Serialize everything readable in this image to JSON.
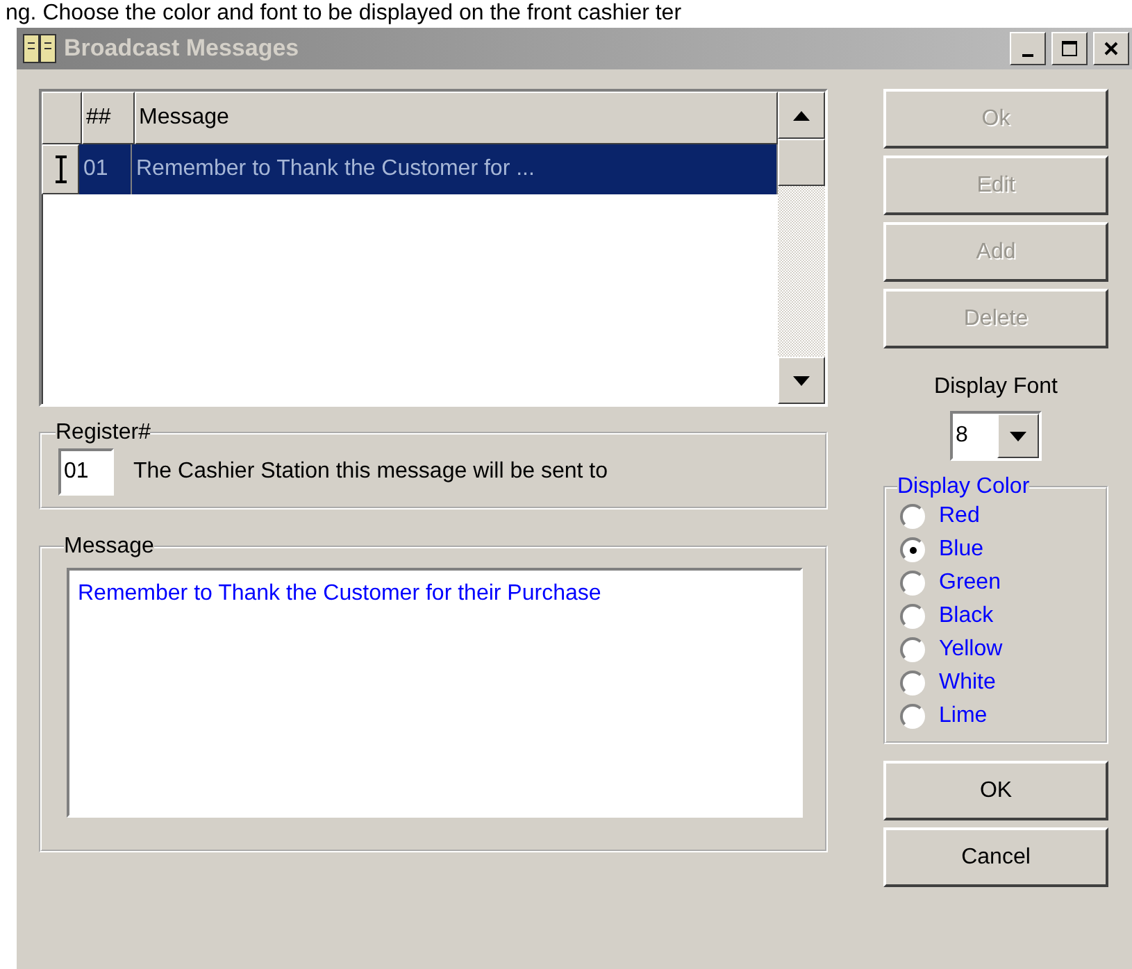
{
  "caption": "ng. Choose the color and font to be displayed on the front cashier ter",
  "window": {
    "title": "Broadcast Messages"
  },
  "grid": {
    "columns": [
      "##",
      "Message"
    ],
    "rows": [
      {
        "number": "01",
        "message": "Remember to Thank the Customer for ...",
        "selected": true
      }
    ]
  },
  "side_buttons": [
    {
      "label": "Ok",
      "disabled": true
    },
    {
      "label": "Edit",
      "disabled": true
    },
    {
      "label": "Add",
      "disabled": true
    },
    {
      "label": "Delete",
      "disabled": true
    }
  ],
  "display_font": {
    "label": "Display Font",
    "value": "8"
  },
  "display_color": {
    "label": "Display Color",
    "options": [
      {
        "label": "Red",
        "selected": false
      },
      {
        "label": "Blue",
        "selected": true
      },
      {
        "label": "Green",
        "selected": false
      },
      {
        "label": "Black",
        "selected": false
      },
      {
        "label": "Yellow",
        "selected": false
      },
      {
        "label": "White",
        "selected": false
      },
      {
        "label": "Lime",
        "selected": false
      }
    ]
  },
  "register": {
    "label": "Register#",
    "value": "01",
    "description": "The Cashier Station this message will be sent to"
  },
  "message": {
    "label": "Message",
    "value": "Remember to Thank the Customer for their Purchase"
  },
  "dialog_buttons": [
    {
      "label": "OK",
      "disabled": false
    },
    {
      "label": "Cancel",
      "disabled": false
    }
  ]
}
